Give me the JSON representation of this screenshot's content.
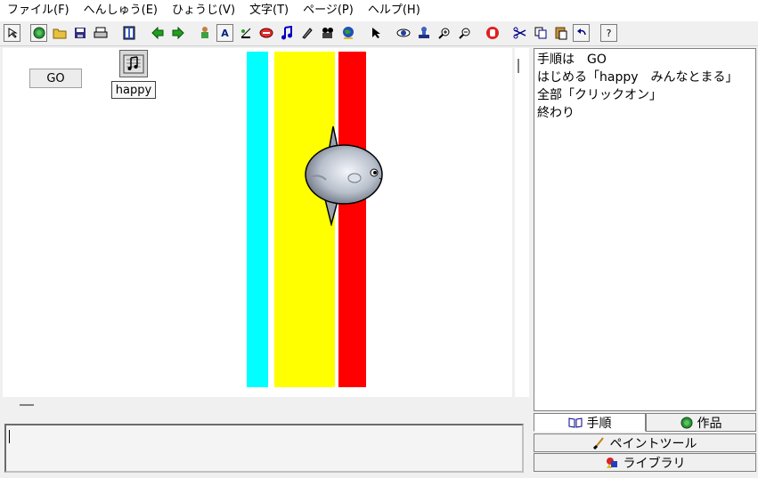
{
  "menu": [
    "ファイル(F)",
    "へんしゅう(E)",
    "ひょうじ(V)",
    "文字(T)",
    "ページ(P)",
    "ヘルプ(H)"
  ],
  "toolbar": {
    "icons": [
      "pointer-select-icon",
      "globe-icon",
      "open-folder-icon",
      "save-icon",
      "print-icon",
      "film-page-icon",
      "arrow-left-icon",
      "arrow-right-icon",
      "character-icon",
      "text-box-icon",
      "satellite-icon",
      "button-shape-icon",
      "music-note-icon",
      "pen-icon",
      "camera-icon",
      "world-icon",
      "cursor-icon",
      "eye-icon",
      "stamp-icon",
      "zoom-in-icon",
      "zoom-out-icon",
      "stop-hand-icon",
      "scissors-icon",
      "copy-icon",
      "paste-icon",
      "undo-icon"
    ],
    "help_label": "?"
  },
  "stage": {
    "go_button": "GO",
    "sound_label": "happy",
    "stripe_colors": [
      "#00ffff",
      "#ffff00",
      "#ff0000"
    ]
  },
  "script": {
    "lines": [
      "手順は　GO",
      "はじめる「happy　みんなとまる」",
      "全部「クリックオン」",
      "終わり"
    ]
  },
  "tabs": {
    "procedure": "手順",
    "works": "作品",
    "paint_tool": "ペイントツール",
    "library": "ライブラリ"
  },
  "bottom_input": {
    "value": ""
  }
}
